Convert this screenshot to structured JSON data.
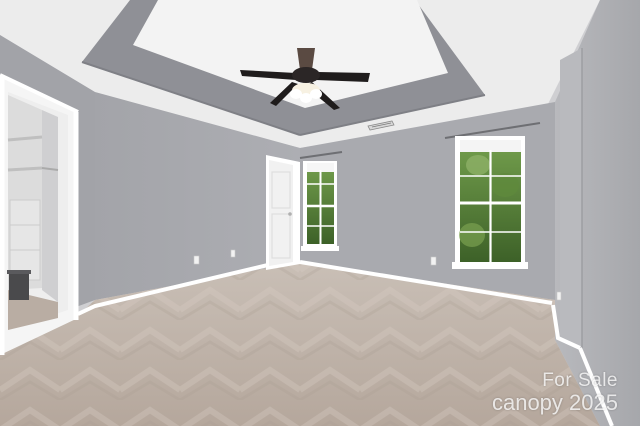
{
  "watermark": {
    "line1": "For Sale",
    "brand": "canopy",
    "year": "2025"
  },
  "colors": {
    "wall": "#a8a9ae",
    "wall_light": "#b4b5b9",
    "ceiling": "#f2f2f2",
    "tray": "#8f9096",
    "carpet": "#bdb1a7",
    "trim": "#ffffff",
    "foliage": "#4f7a34"
  },
  "icons": [
    "ceiling-fan-icon",
    "floor-vent-icon",
    "outlet-icon"
  ]
}
